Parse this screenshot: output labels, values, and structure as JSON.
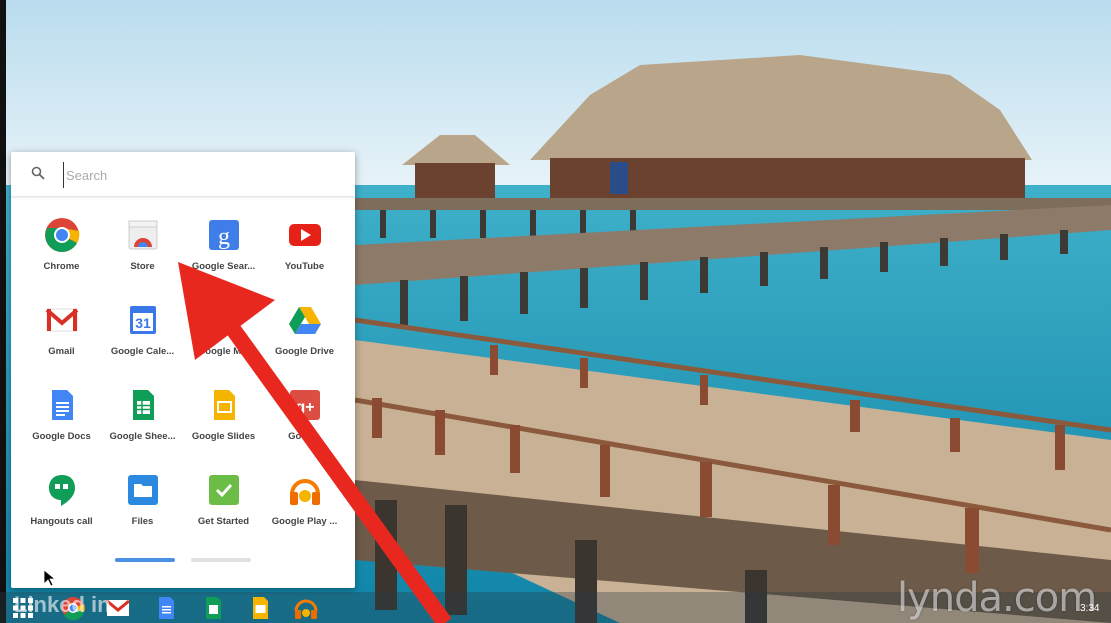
{
  "launcher": {
    "search_placeholder": "Search",
    "apps": [
      {
        "label": "Chrome",
        "icon": "chrome-icon"
      },
      {
        "label": "Store",
        "icon": "store-icon"
      },
      {
        "label": "Google Sear...",
        "icon": "google-search-icon"
      },
      {
        "label": "YouTube",
        "icon": "youtube-icon"
      },
      {
        "label": "Gmail",
        "icon": "gmail-icon"
      },
      {
        "label": "Google Cale...",
        "icon": "calendar-icon"
      },
      {
        "label": "Google M...",
        "icon": "maps-icon"
      },
      {
        "label": "Google Drive",
        "icon": "drive-icon"
      },
      {
        "label": "Google Docs",
        "icon": "docs-icon"
      },
      {
        "label": "Google Shee...",
        "icon": "sheets-icon"
      },
      {
        "label": "Google Slides",
        "icon": "slides-icon"
      },
      {
        "label": "Goog...",
        "icon": "google-plus-icon"
      },
      {
        "label": "Hangouts call",
        "icon": "hangouts-icon"
      },
      {
        "label": "Files",
        "icon": "files-icon"
      },
      {
        "label": "Get Started",
        "icon": "get-started-icon"
      },
      {
        "label": "Google Play ...",
        "icon": "play-music-icon"
      }
    ],
    "calendar_day": "31",
    "pages": {
      "count": 2,
      "current": 1
    }
  },
  "watermark": "lynda.com",
  "branding": "Linked in",
  "clock": "3:34",
  "colors": {
    "accent_blue": "#4a90e2",
    "arrow_red": "#e8281f"
  }
}
